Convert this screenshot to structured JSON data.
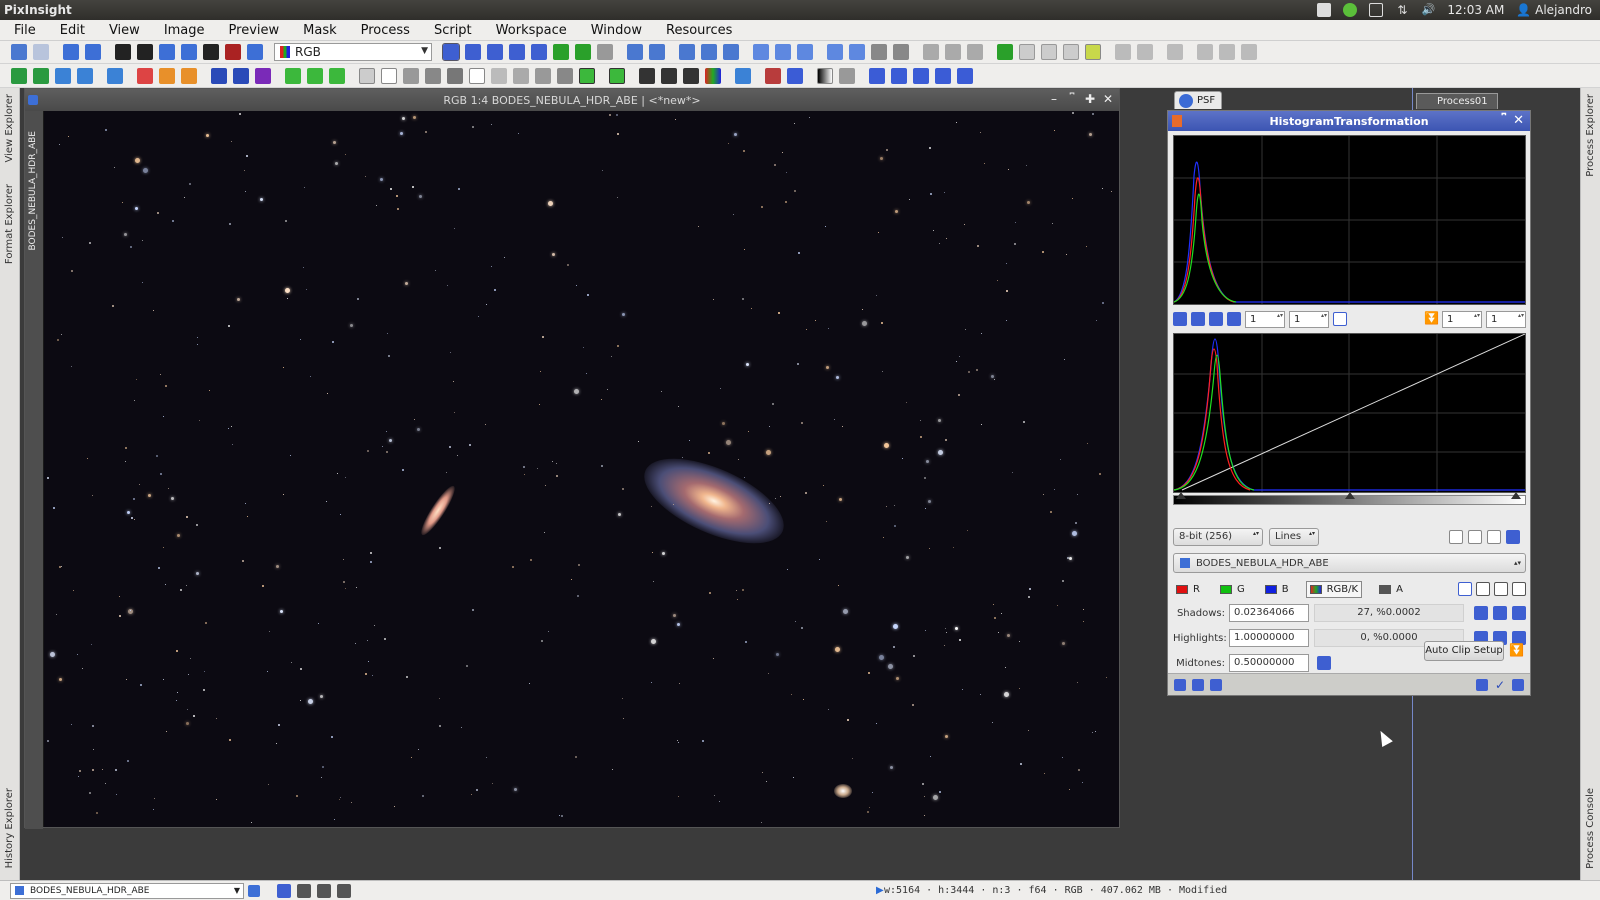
{
  "topbar": {
    "app_title": "PixInsight",
    "clock": "12:03 AM",
    "user": "Alejandro",
    "tray_icons": [
      "edit-icon",
      "vpn-icon",
      "mail-icon",
      "network-icon",
      "volume-icon"
    ]
  },
  "menubar": {
    "items": [
      "File",
      "Edit",
      "View",
      "Image",
      "Preview",
      "Mask",
      "Process",
      "Script",
      "Workspace",
      "Window",
      "Resources"
    ]
  },
  "toolbar": {
    "color_mode": "RGB"
  },
  "left_dock": {
    "tabs": [
      "View Explorer",
      "Format Explorer",
      "History Explorer"
    ]
  },
  "right_dock": {
    "tabs": [
      "Process Explorer",
      "Process Console"
    ]
  },
  "image_window": {
    "title": "RGB 1:4 BODES_NEBULA_HDR_ABE | <*new*>",
    "side_label": "BODES_NEBULA_HDR_ABE"
  },
  "icons": {
    "psf_label": "PSF",
    "process_label": "Process01"
  },
  "histogram": {
    "title": "HistogramTransformation",
    "zoom_h": "1",
    "zoom_v": "1",
    "zoom_h2": "1",
    "zoom_v2": "1",
    "resolution": "8-bit (256)",
    "graph_style": "Lines",
    "target_view": "BODES_NEBULA_HDR_ABE",
    "channels": [
      {
        "label": "R",
        "color": "#e01010"
      },
      {
        "label": "G",
        "color": "#10c010"
      },
      {
        "label": "B",
        "color": "#1020e0"
      },
      {
        "label": "RGB/K",
        "color": "#333333"
      },
      {
        "label": "A",
        "color": "#333333"
      }
    ],
    "shadows_label": "Shadows:",
    "shadows_value": "0.02364066",
    "shadows_stat": "27, %0.0002",
    "highlights_label": "Highlights:",
    "highlights_value": "1.00000000",
    "highlights_stat": "0, %0.0000",
    "midtones_label": "Midtones:",
    "midtones_value": "0.50000000",
    "auto_clip": "Auto Clip Setup"
  },
  "statusbar": {
    "view_name": "BODES_NEBULA_HDR_ABE",
    "info": "w:5164 · h:3444 · n:3 · f64 · RGB · 407.062 MB · Modified"
  }
}
